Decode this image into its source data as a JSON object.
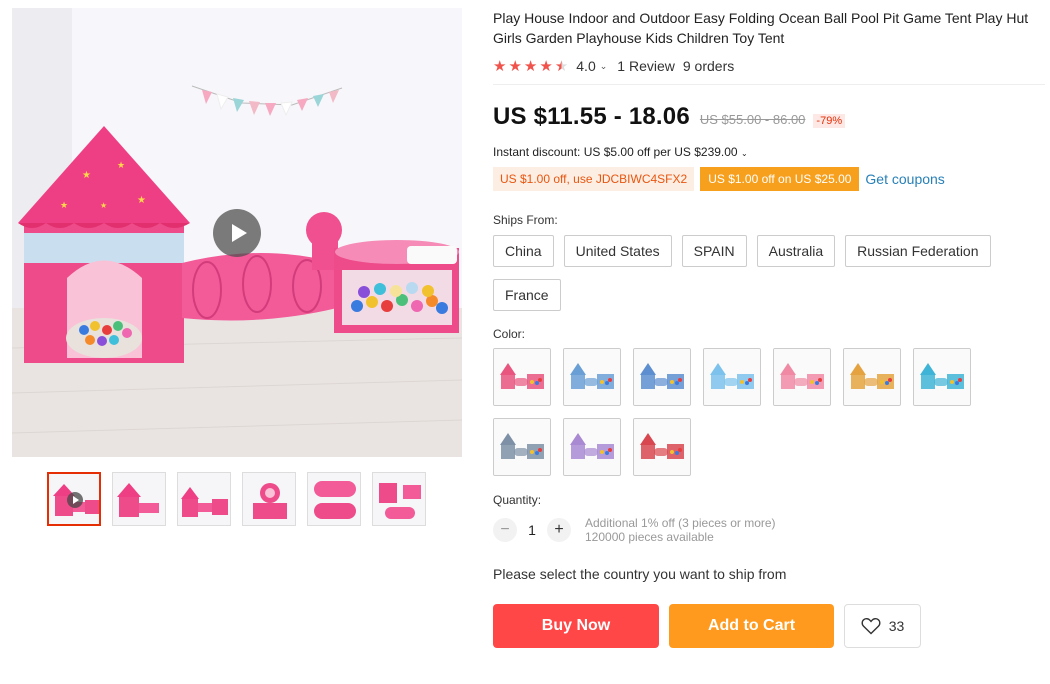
{
  "product": {
    "title": "Play House Indoor and Outdoor Easy Folding Ocean Ball Pool Pit Game Tent Play Hut Girls Garden Playhouse Kids Children Toy Tent",
    "rating": "4.0",
    "rating_stars": 4,
    "reviews": "1 Review",
    "orders": "9 orders"
  },
  "price": {
    "current": "US $11.55 - 18.06",
    "original": "US $55.00 - 86.00",
    "discount": "-79%"
  },
  "instant_discount": "Instant discount: US $5.00 off per US $239.00",
  "coupons": {
    "code_coupon": "US $1.00 off, use JDCBIWC4SFX2",
    "store_coupon": "US $1.00 off on US $25.00",
    "link": "Get coupons"
  },
  "ships_from": {
    "label": "Ships From:",
    "options": [
      "China",
      "United States",
      "SPAIN",
      "Australia",
      "Russian Federation",
      "France"
    ]
  },
  "color": {
    "label": "Color:",
    "swatch_colors": [
      "#e8557f",
      "#6a9fd6",
      "#5d8fd0",
      "#7cc2ec",
      "#f08aa4",
      "#e4a340",
      "#3fb4d6",
      "#7d90a6",
      "#a889d2",
      "#d8474f"
    ]
  },
  "quantity": {
    "label": "Quantity:",
    "value": "1",
    "minus": "−",
    "plus": "+",
    "discount_note": "Additional 1% off (3 pieces or more)",
    "available": "120000 pieces available"
  },
  "ship_message": "Please select the country you want to ship from",
  "actions": {
    "buy_now": "Buy Now",
    "add_to_cart": "Add to Cart",
    "wishlist_count": "33"
  },
  "colors": {
    "accent_red": "#ff4747",
    "accent_orange": "#ff9a1f",
    "star": "#f0524c",
    "link_blue": "#2880b8"
  }
}
